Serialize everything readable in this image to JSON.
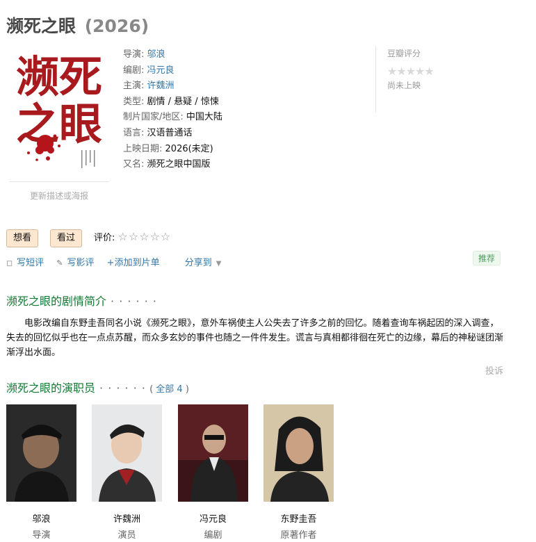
{
  "movie": {
    "title": "濒死之眼",
    "year": "(2026)",
    "poster_update": "更新描述或海报",
    "poster_text": {
      "line1": "濒死",
      "line2": "之眼"
    }
  },
  "info": [
    {
      "key": "导演:",
      "value": "邬浪",
      "link": true
    },
    {
      "key": "编剧:",
      "value": "冯元良",
      "link": true
    },
    {
      "key": "主演:",
      "value": "许魏洲",
      "link": true
    },
    {
      "key": "类型:",
      "value": "剧情 / 悬疑 / 惊悚",
      "link": false
    },
    {
      "key": "制片国家/地区:",
      "value": "中国大陆",
      "link": false
    },
    {
      "key": "语言:",
      "value": "汉语普通话",
      "link": false
    },
    {
      "key": "上映日期:",
      "value": "2026(未定)",
      "link": false
    },
    {
      "key": "又名:",
      "value": "濒死之眼中国版",
      "link": false
    }
  ],
  "rating": {
    "label": "豆瓣评分",
    "stars": "★★★★★",
    "status": "尚未上映"
  },
  "interest": {
    "want": "想看",
    "seen": "看过",
    "rate_label": "评价:",
    "rate_stars": "☆☆☆☆☆"
  },
  "actions": {
    "write_short": "写短评",
    "write_review": "写影评",
    "add_list": "+添加到片单",
    "share": "分享到",
    "recommend": "推荐"
  },
  "sections": {
    "summary_title": "濒死之眼的剧情简介",
    "dots": "· · · · · ·",
    "summary": "电影改编自东野圭吾同名小说《濒死之眼》，意外车祸使主人公失去了许多之前的回忆。随着查询车祸起因的深入调查，失去的回忆似乎也在一点点苏醒，而众多玄妙的事件也随之一件件发生。谎言与真相都徘徊在死亡的边缘，幕后的神秘谜团渐渐浮出水面。",
    "report": "投诉",
    "cast_title": "濒死之眼的演职员",
    "cast_all_open": "( ",
    "cast_all": "全部 4",
    "cast_all_close": " )"
  },
  "cast": [
    {
      "name": "邬浪",
      "role": "导演"
    },
    {
      "name": "许魏洲",
      "role": "演员"
    },
    {
      "name": "冯元良",
      "role": "编剧"
    },
    {
      "name": "东野圭吾",
      "role": "原著作者"
    }
  ]
}
